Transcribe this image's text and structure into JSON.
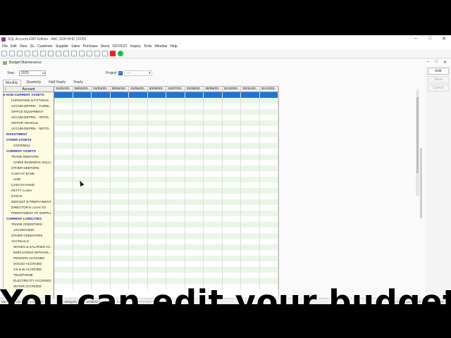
{
  "window": {
    "title": "SQL Account ERP Edition - ABC SDN BHD (2025)",
    "controls": [
      "minimize",
      "maximize",
      "close"
    ]
  },
  "menu": [
    "File",
    "Edit",
    "View",
    "GL",
    "Customer",
    "Supplier",
    "Sales",
    "Purchase",
    "Stock",
    "SST/GST",
    "Inquiry",
    "Tools",
    "Window",
    "Help"
  ],
  "toolbar_icons": [
    "home-icon",
    "back-icon",
    "forward-icon",
    "document-icon",
    "document-icon",
    "document-icon",
    "document-icon",
    "document-icon",
    "document-icon",
    "document-icon",
    "document-icon",
    "document-icon",
    "printer-icon",
    "document-icon",
    "youtube-icon",
    "whatsapp-icon"
  ],
  "document": {
    "title": "Budget Maintenance",
    "year_label": "Year :",
    "year_value": "2025",
    "project_label": "Project",
    "project_value": "----",
    "tabs": [
      "Monthly",
      "Quarterly",
      "Half Yearly",
      "Yearly"
    ],
    "active_tab": "Monthly",
    "buttons": {
      "edit": "Edit",
      "save": "Save",
      "cancel": "Cancel"
    }
  },
  "grid": {
    "account_header": "Account",
    "month_headers": [
      "31/01/20..",
      "28/02/20..",
      "31/03/20..",
      "30/04/20..",
      "31/05/20..",
      "30/06/20..",
      "31/07/20..",
      "31/08/20..",
      "30/09/20..",
      "31/10/20..",
      "30/11/20..",
      "31/12/20.."
    ],
    "accounts": [
      {
        "label": "NON-CURRENT ASSETS",
        "type": "group",
        "selected": true
      },
      {
        "label": "FURNITURE & FITTINGS",
        "type": "lvl1"
      },
      {
        "label": "ACCUM DEPRN. - FURNI..",
        "type": "lvl1"
      },
      {
        "label": "OFFICE EQUIPMENT",
        "type": "lvl1"
      },
      {
        "label": "ACCUM DEPRN. - OFFIC..",
        "type": "lvl1"
      },
      {
        "label": "MOTOR VEHICLE",
        "type": "lvl1"
      },
      {
        "label": "ACCUM DEPRN. - MOTO..",
        "type": "lvl1"
      },
      {
        "label": "INVESTMENT",
        "type": "group"
      },
      {
        "label": "OTHER ASSETS",
        "type": "group"
      },
      {
        "label": "GOODWILL",
        "type": "lvl2"
      },
      {
        "label": "CURRENT ASSETS",
        "type": "group"
      },
      {
        "label": "TRADE DEBTORS",
        "type": "lvl1"
      },
      {
        "label": "CHRIS BUSINESS SOLU..",
        "type": "lvl2"
      },
      {
        "label": "OTHER DEBTORS",
        "type": "lvl1"
      },
      {
        "label": "CASH AT BANK",
        "type": "lvl1"
      },
      {
        "label": "UOB",
        "type": "lvl2"
      },
      {
        "label": "CASH IN HAND",
        "type": "lvl1"
      },
      {
        "label": "PETTY CASH",
        "type": "lvl1"
      },
      {
        "label": "STOCK",
        "type": "lvl1"
      },
      {
        "label": "DEPOSIT & PREPAYMENT",
        "type": "lvl1"
      },
      {
        "label": "DIRECTOR'S LOAN TO",
        "type": "lvl1"
      },
      {
        "label": "PREPAYMENT TO SUPPLI..",
        "type": "lvl1"
      },
      {
        "label": "CURRENT LIABILITIES",
        "type": "group"
      },
      {
        "label": "TRADE CREDITORS",
        "type": "lvl1"
      },
      {
        "label": "123 SDN BHD",
        "type": "lvl2"
      },
      {
        "label": "OTHER CREDITORS",
        "type": "lvl1"
      },
      {
        "label": "ACCRUALS",
        "type": "lvl1"
      },
      {
        "label": "WAGES & SALARIES AC..",
        "type": "lvl2"
      },
      {
        "label": "EMPLOYEES WITHHOL..",
        "type": "lvl2"
      },
      {
        "label": "PENSION ACCRUED",
        "type": "lvl2"
      },
      {
        "label": "SOCSO ACCRUED",
        "type": "lvl2"
      },
      {
        "label": "CS & W ACCRUED",
        "type": "lvl2"
      },
      {
        "label": "TELEPHONE",
        "type": "lvl2"
      },
      {
        "label": "ELECTRICITY ACCRUED",
        "type": "lvl2"
      },
      {
        "label": "WATER ACCRUED",
        "type": "lvl2"
      }
    ]
  },
  "status": {
    "version": "Version 5.2025.1043.880 x86",
    "working_date_label": "Working Date",
    "working_date": "11/09/2025",
    "user": "ADMIN",
    "keys": "CAPS NUM SCRL INS",
    "right": "Hurry! Claim your Firebird 5.0.3 TCPv6 x64"
  },
  "caption": "You can edit your budget"
}
